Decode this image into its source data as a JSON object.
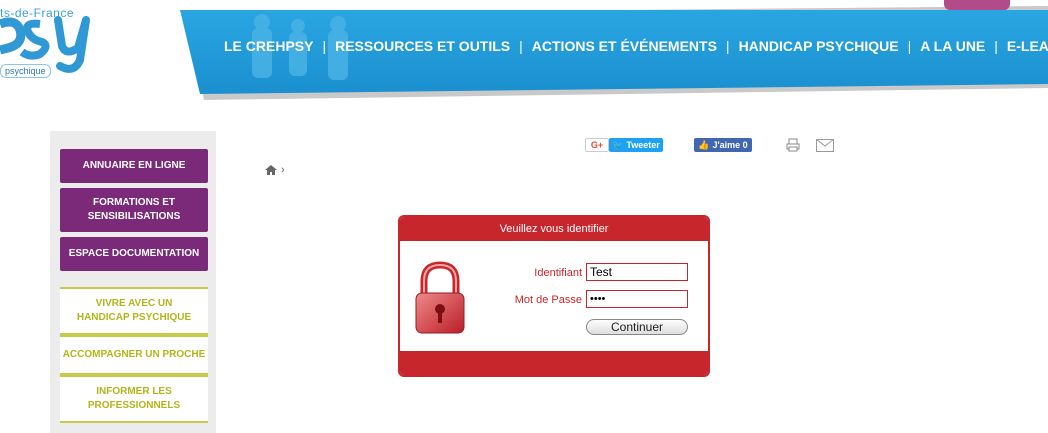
{
  "header": {
    "logo_region_text": "ts-de-France",
    "logo_sub_text": "psychique",
    "nav": [
      {
        "label": "LE CREHPSY"
      },
      {
        "label": "RESSOURCES ET OUTILS"
      },
      {
        "label": "ACTIONS ET ÉVÉNEMENTS"
      },
      {
        "label": "HANDICAP PSYCHIQUE"
      },
      {
        "label": "A LA UNE"
      },
      {
        "label": "E-LEARNING"
      }
    ],
    "nav_separator": "|"
  },
  "sidebar": {
    "primary": [
      {
        "label": "ANNUAIRE EN LIGNE"
      },
      {
        "label": "FORMATIONS ET SENSIBILISATIONS"
      },
      {
        "label": "ESPACE DOCUMENTATION"
      }
    ],
    "secondary": [
      {
        "label": "VIVRE AVEC UN HANDICAP PSYCHIQUE"
      },
      {
        "label": "ACCOMPAGNER UN PROCHE"
      },
      {
        "label": "INFORMER LES PROFESSIONNELS"
      }
    ]
  },
  "share": {
    "gplus": "G+",
    "tweet": "Tweeter",
    "like": "J'aime 0"
  },
  "breadcrumb": {
    "separator": "›"
  },
  "login": {
    "title": "Veuillez vous identifier",
    "identifiant_label": "Identifiant",
    "identifiant_value": "Test",
    "password_label": "Mot de Passe",
    "password_value": "••••",
    "submit_label": "Continuer"
  },
  "colors": {
    "header_blue": "#1e9ad8",
    "sidebar_purple": "#7a2a78",
    "sidebar_olive": "#b2b51a",
    "login_red": "#c8262d"
  }
}
